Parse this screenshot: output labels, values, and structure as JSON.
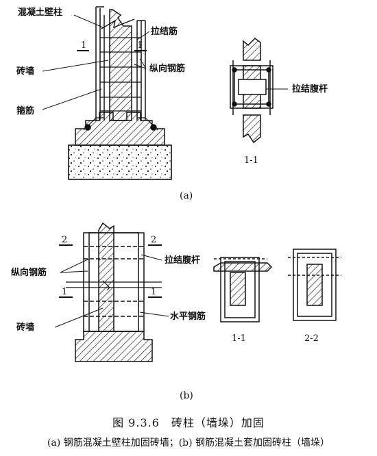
{
  "labels": {
    "concrete_pilaster": "混凝土壁柱",
    "tie_bar_a": "拉结筋",
    "brick_wall_a": "砖墙",
    "longitudinal_bar_a": "纵向钢筋",
    "stirrup": "箍筋",
    "tie_web_bar_a": "拉结腹杆",
    "tie_web_bar_b": "拉结腹杆",
    "longitudinal_bar_b": "纵向钢筋",
    "brick_wall_b": "砖墙",
    "horizontal_bar": "水平钢筋"
  },
  "section_marks": {
    "a_left": "1",
    "a_right": "1",
    "b_2_left": "2",
    "b_2_right": "2",
    "b_1_left": "1",
    "b_1_right": "1"
  },
  "section_titles": {
    "a": "1-1",
    "b1": "1-1",
    "b2": "2-2"
  },
  "subfigures": {
    "a": "(a)",
    "b": "(b)"
  },
  "caption": {
    "title": "图 9.3.6　砖柱（墙垛）加固",
    "subtitle": "(a) 钢筋混凝土壁柱加固砖墙；(b) 钢筋混凝土套加固砖柱（墙垛）"
  }
}
